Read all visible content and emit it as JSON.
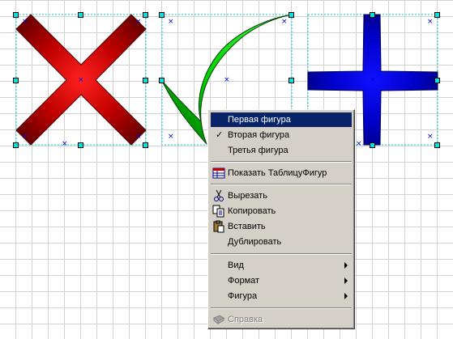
{
  "context_menu": {
    "items": [
      {
        "label": "Первая фигура"
      },
      {
        "label": "Вторая фигура",
        "checked": true
      },
      {
        "label": "Третья фигура"
      },
      {
        "label": "Показать ТаблицуФигур",
        "icon": "table-icon"
      },
      {
        "label": "Вырезать",
        "icon": "scissors-icon"
      },
      {
        "label": "Копировать",
        "icon": "copy-icon"
      },
      {
        "label": "Вставить",
        "icon": "paste-icon"
      },
      {
        "label": "Дублировать"
      },
      {
        "label": "Вид",
        "submenu": true
      },
      {
        "label": "Формат",
        "submenu": true
      },
      {
        "label": "Фигура",
        "submenu": true
      },
      {
        "label": "Справка",
        "icon": "help-book-icon",
        "disabled": true
      }
    ]
  },
  "colors": {
    "highlight": "#0a246a",
    "menu_bg": "#d4d0c8",
    "handle": "#00e6e6",
    "grid": "#d2d2d2"
  }
}
